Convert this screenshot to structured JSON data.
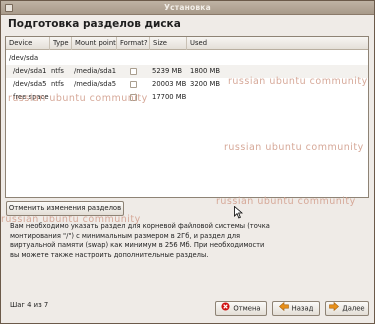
{
  "window": {
    "title": "Установка"
  },
  "page": {
    "header": "Подготовка разделов диска"
  },
  "table": {
    "columns": [
      "Device",
      "Type",
      "Mount point",
      "Format?",
      "Size",
      "Used"
    ],
    "disk": "/dev/sda",
    "rows": [
      {
        "device": "/dev/sda1",
        "type": "ntfs",
        "mount": "/media/sda1",
        "format": false,
        "size": "5239 MB",
        "used": "1800 MB"
      },
      {
        "device": "/dev/sda5",
        "type": "ntfs",
        "mount": "/media/sda5",
        "format": false,
        "size": "20003 MB",
        "used": "3200 MB"
      },
      {
        "device": "free space",
        "type": "",
        "mount": "",
        "format": false,
        "size": "17700 MB",
        "used": ""
      }
    ]
  },
  "watermark": {
    "line1": "russian ubuntu community"
  },
  "buttons": {
    "undo": "Отменить изменения разделов",
    "cancel": "Отмена",
    "back": "Назад",
    "forward": "Далее"
  },
  "info": "Вам необходимо указать раздел для корневой файловой системы (точка монтирования \"/\") с минимальным размером в 2Гб, и раздел для виртуальной памяти (swap) как минимум в 256 Мб. При необходимости вы можете также настроить дополнительные разделы.",
  "status": {
    "step": "Шаг 4 из 7"
  },
  "colors": {
    "window_bg": "#efebe7",
    "titlebar": "#a89a8a",
    "watermark": "#d6a898",
    "cancel_icon": "#d01010",
    "nav_icon": "#e8901a"
  }
}
